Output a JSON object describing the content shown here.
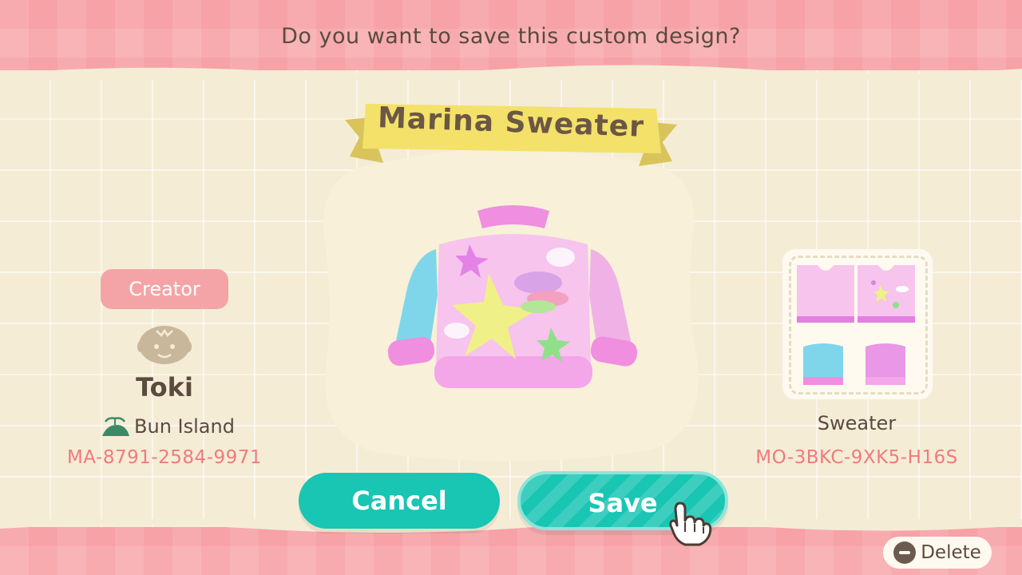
{
  "dialog": {
    "prompt": "Do you want to save this custom design?",
    "design_name": "Marina Sweater"
  },
  "creator": {
    "badge_label": "Creator",
    "avatar_icon": "villager-face-icon",
    "name": "Toki",
    "island_icon": "island-icon",
    "island": "Bun Island",
    "creator_id": "MA-8791-2584-9971"
  },
  "design": {
    "item_type": "Sweater",
    "design_id": "MO-3BKC-9XK5-H16S"
  },
  "buttons": {
    "cancel": "Cancel",
    "save": "Save"
  },
  "footer": {
    "delete_label": "Delete",
    "delete_icon": "minus-icon"
  },
  "colors": {
    "background_pink": "#f6a2a6",
    "panel_cream": "#f5ecd6",
    "button_teal": "#19c5b3",
    "banner_yellow": "#f3e16a",
    "id_pink": "#f07a7f",
    "text_brown": "#5b4a3f"
  }
}
